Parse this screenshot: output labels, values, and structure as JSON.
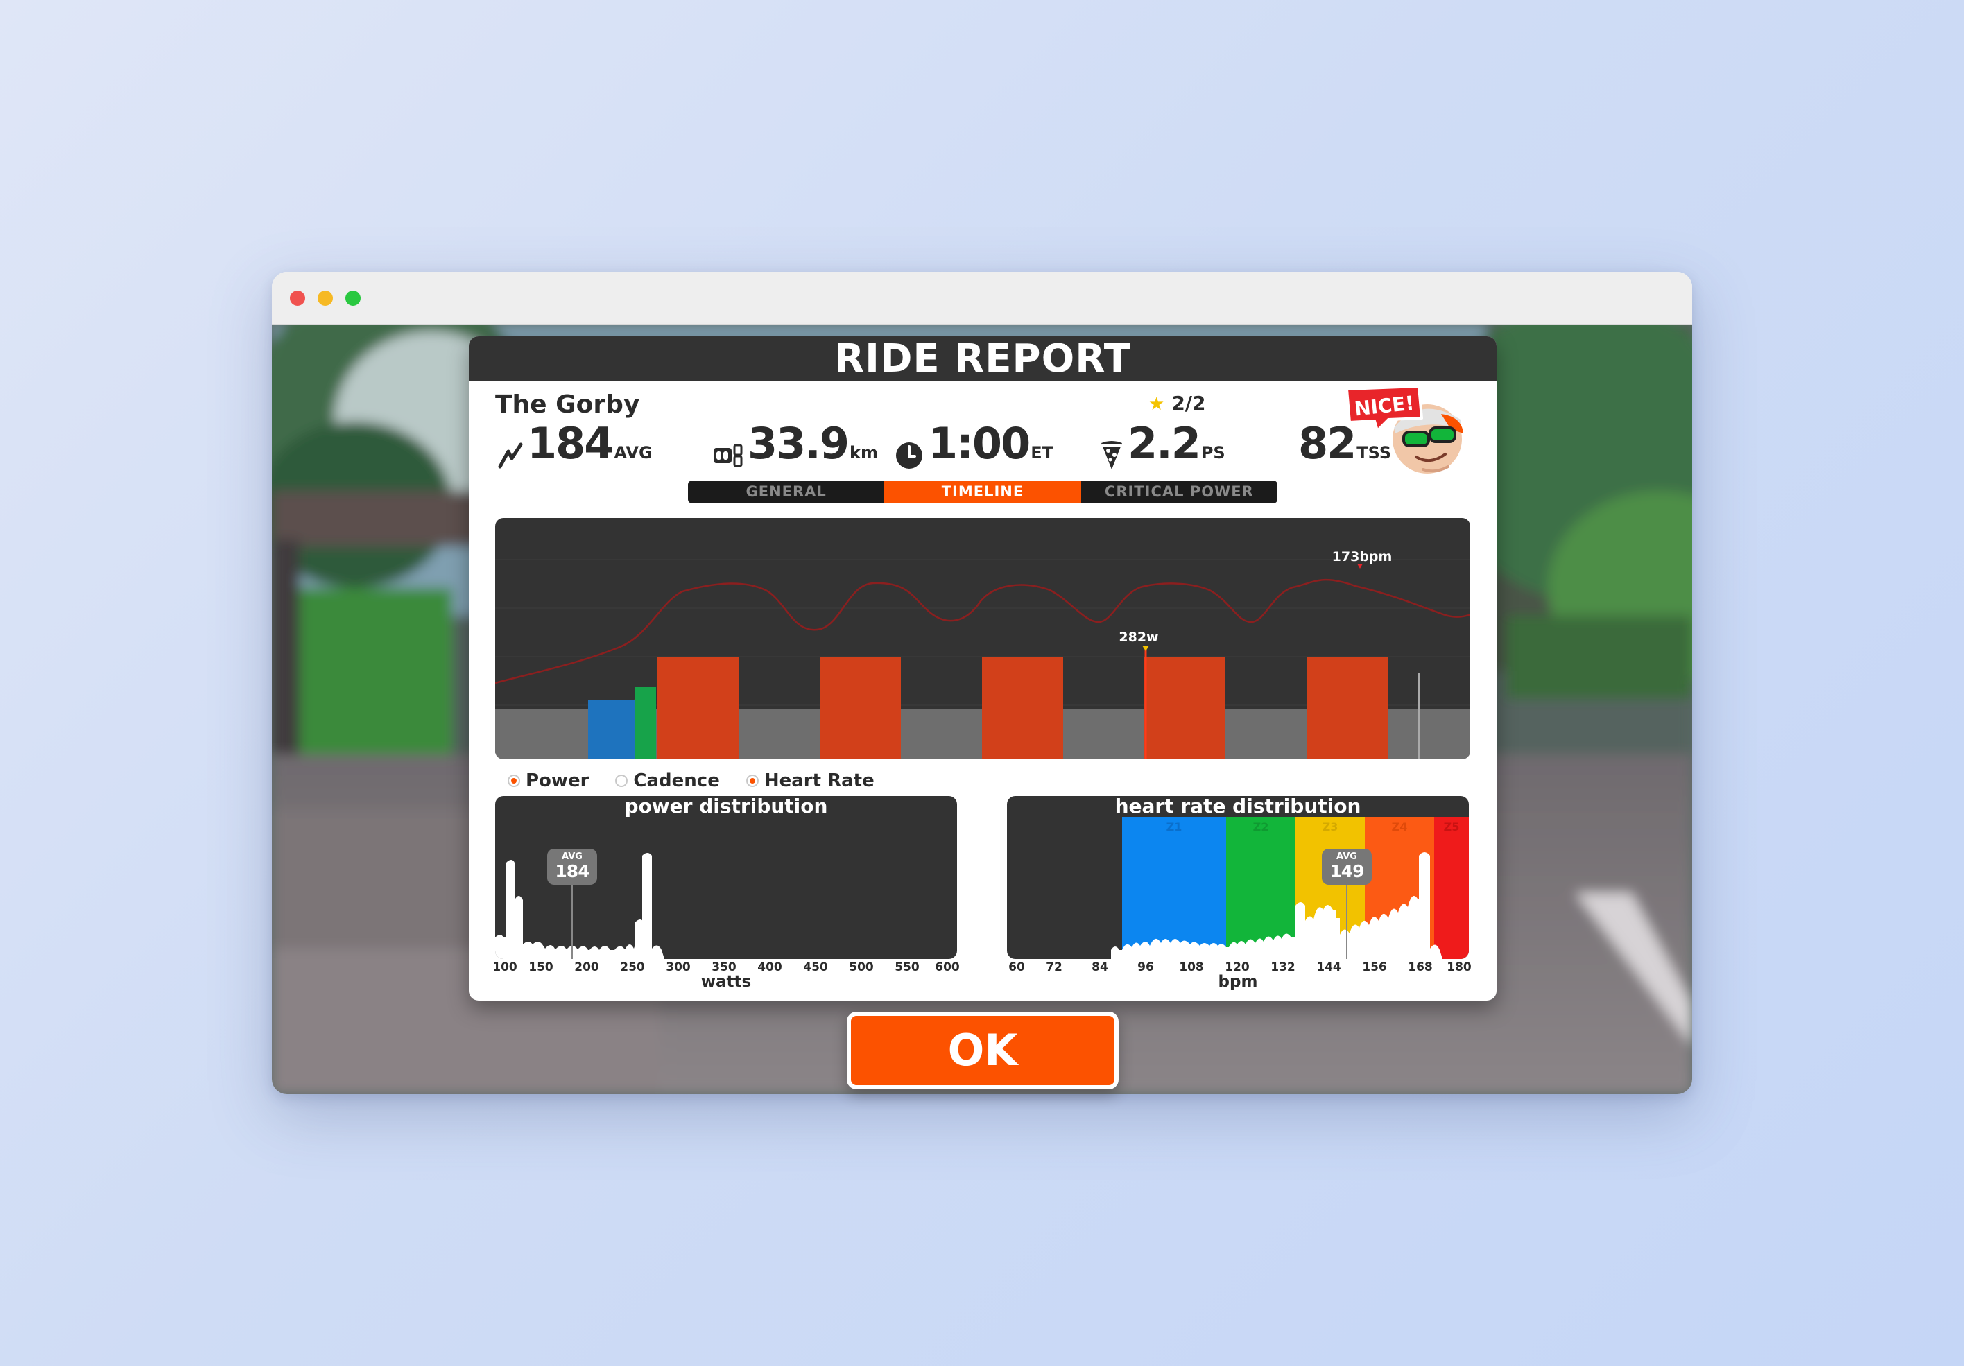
{
  "panel": {
    "title": "RIDE REPORT",
    "rider_name": "The Gorby",
    "badge": "NICE!",
    "stars": "2/2",
    "stats": {
      "power": {
        "value": "184",
        "unit": "AVG"
      },
      "distance": {
        "value": "33.9",
        "unit": "km"
      },
      "time": {
        "value": "1:00",
        "unit": "ET"
      },
      "pizza": {
        "value": "2.2",
        "unit": "PS"
      },
      "tss": {
        "value": "82",
        "unit": "TSS"
      }
    },
    "tabs": [
      "GENERAL",
      "TIMELINE",
      "CRITICAL POWER"
    ],
    "active_tab": "TIMELINE"
  },
  "timeline": {
    "power_peak_label": "282w",
    "hr_peak_label": "173bpm",
    "colors": {
      "grey": "#6e6e6e",
      "blue": "#1e73be",
      "green": "#17a34a",
      "orange": "#d2401a",
      "hr_line": "#8b1f1f"
    }
  },
  "legend": {
    "power": "Power",
    "cadence": "Cadence",
    "heart_rate": "Heart Rate",
    "power_on": true,
    "cadence_on": false,
    "heart_rate_on": true
  },
  "power_distribution": {
    "title": "power distribution",
    "avg_label": "AVG",
    "avg_value": "184",
    "xlabel": "watts",
    "ticks": [
      "100",
      "150",
      "200",
      "250",
      "300",
      "350",
      "400",
      "450",
      "500",
      "550",
      "600"
    ]
  },
  "hr_distribution": {
    "title": "heart rate distribution",
    "avg_label": "AVG",
    "avg_value": "149",
    "xlabel": "bpm",
    "ticks": [
      "60",
      "72",
      "84",
      "96",
      "108",
      "120",
      "132",
      "144",
      "156",
      "168",
      "180"
    ],
    "zones": [
      "Z1",
      "Z2",
      "Z3",
      "Z4",
      "Z5"
    ],
    "zone_colors": [
      "#0c86f0",
      "#12b53a",
      "#f2c200",
      "#fc5a14",
      "#ef1b1b"
    ]
  },
  "ok_button": "OK"
}
